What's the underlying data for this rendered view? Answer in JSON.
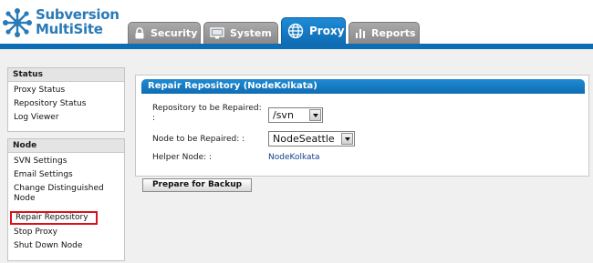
{
  "brand": {
    "line1": "Subversion",
    "line2": "MultiSite",
    "color": "#2a7ab8"
  },
  "tabs": [
    {
      "label": "Security",
      "icon": "lock-icon"
    },
    {
      "label": "System",
      "icon": "monitor-icon"
    },
    {
      "label": "Proxy",
      "icon": "globe-icon",
      "active": true
    },
    {
      "label": "Reports",
      "icon": "bar-chart-icon"
    }
  ],
  "sidebar": {
    "status": {
      "title": "Status",
      "items": [
        "Proxy Status",
        "Repository Status",
        "Log Viewer"
      ]
    },
    "node": {
      "title": "Node",
      "items": [
        "SVN Settings",
        "Email Settings",
        "Change Distinguished Node",
        "Repair Repository",
        "Stop Proxy",
        "Shut Down Node"
      ],
      "selected": "Repair Repository"
    }
  },
  "panel": {
    "title": "Repair Repository (NodeKolkata)",
    "fields": {
      "repository_label_line1": "Repository to be Repaired:",
      "repository_label_line2": ":",
      "repository_value": "/svn",
      "node_label": "Node to be Repaired: :",
      "node_value": "NodeSeattle",
      "helper_label": "Helper Node: :",
      "helper_value": "NodeKolkata"
    }
  },
  "actions": {
    "prepare_label": "Prepare for Backup"
  },
  "colors": {
    "accent": "#0f6db4",
    "highlight": "#d8121c"
  }
}
